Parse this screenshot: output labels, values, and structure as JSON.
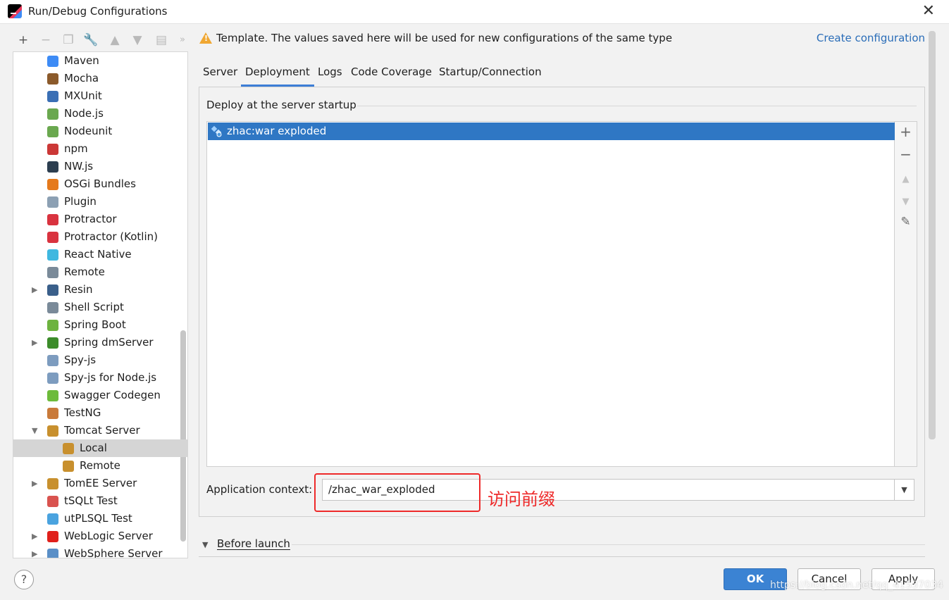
{
  "window": {
    "title": "Run/Debug Configurations"
  },
  "tree": {
    "items": [
      {
        "label": "Maven",
        "icon": "maven-icon",
        "color": "#3d8bf5",
        "expandable": false
      },
      {
        "label": "Mocha",
        "icon": "mocha-icon",
        "color": "#8b5a2b",
        "expandable": false
      },
      {
        "label": "MXUnit",
        "icon": "mxunit-icon",
        "color": "#3a6fb5",
        "expandable": false
      },
      {
        "label": "Node.js",
        "icon": "nodejs-icon",
        "color": "#6aa84f",
        "expandable": false
      },
      {
        "label": "Nodeunit",
        "icon": "nodeunit-icon",
        "color": "#6aa84f",
        "expandable": false
      },
      {
        "label": "npm",
        "icon": "npm-icon",
        "color": "#cb3837",
        "expandable": false
      },
      {
        "label": "NW.js",
        "icon": "nwjs-icon",
        "color": "#2c3e50",
        "expandable": false
      },
      {
        "label": "OSGi Bundles",
        "icon": "osgi-icon",
        "color": "#e57a1c",
        "expandable": false
      },
      {
        "label": "Plugin",
        "icon": "plugin-icon",
        "color": "#8ca0b3",
        "expandable": false
      },
      {
        "label": "Protractor",
        "icon": "protractor-icon",
        "color": "#d9333f",
        "expandable": false
      },
      {
        "label": "Protractor (Kotlin)",
        "icon": "protractor-kotlin-icon",
        "color": "#d9333f",
        "expandable": false
      },
      {
        "label": "React Native",
        "icon": "react-native-icon",
        "color": "#3fb8e0",
        "expandable": false
      },
      {
        "label": "Remote",
        "icon": "remote-icon",
        "color": "#7a8a99",
        "expandable": false
      },
      {
        "label": "Resin",
        "icon": "resin-icon",
        "color": "#3a5f8a",
        "expandable": true
      },
      {
        "label": "Shell Script",
        "icon": "shell-script-icon",
        "color": "#7a8a99",
        "expandable": false
      },
      {
        "label": "Spring Boot",
        "icon": "spring-boot-icon",
        "color": "#6db33f",
        "expandable": false
      },
      {
        "label": "Spring dmServer",
        "icon": "spring-dmserver-icon",
        "color": "#3c8c2a",
        "expandable": true
      },
      {
        "label": "Spy-js",
        "icon": "spyjs-icon",
        "color": "#7d9cbf",
        "expandable": false
      },
      {
        "label": "Spy-js for Node.js",
        "icon": "spyjs-node-icon",
        "color": "#7d9cbf",
        "expandable": false
      },
      {
        "label": "Swagger Codegen",
        "icon": "swagger-icon",
        "color": "#6dbb3b",
        "expandable": false
      },
      {
        "label": "TestNG",
        "icon": "testng-icon",
        "color": "#c97a3a",
        "expandable": false
      },
      {
        "label": "Tomcat Server",
        "icon": "tomcat-icon",
        "color": "#c8902e",
        "expandable": true,
        "expanded": true
      },
      {
        "label": "Local",
        "icon": "tomcat-local-icon",
        "color": "#c8902e",
        "expandable": false,
        "child": true,
        "selected": true
      },
      {
        "label": "Remote",
        "icon": "tomcat-remote-icon",
        "color": "#c8902e",
        "expandable": false,
        "child": true
      },
      {
        "label": "TomEE Server",
        "icon": "tomee-icon",
        "color": "#c8902e",
        "expandable": true
      },
      {
        "label": "tSQLt Test",
        "icon": "tsqlt-icon",
        "color": "#d9534f",
        "expandable": false
      },
      {
        "label": "utPLSQL Test",
        "icon": "utplsql-icon",
        "color": "#4aa3df",
        "expandable": false
      },
      {
        "label": "WebLogic Server",
        "icon": "weblogic-icon",
        "color": "#e0201b",
        "expandable": true
      },
      {
        "label": "WebSphere Server",
        "icon": "websphere-icon",
        "color": "#5a8fc7",
        "expandable": true
      }
    ]
  },
  "header": {
    "template_note": "Template. The values saved here will be used for new configurations of the same type",
    "create_link": "Create configuration"
  },
  "tabs": [
    {
      "label": "Server",
      "active": false
    },
    {
      "label": "Deployment",
      "active": true
    },
    {
      "label": "Logs",
      "active": false
    },
    {
      "label": "Code Coverage",
      "active": false
    },
    {
      "label": "Startup/Connection",
      "active": false
    }
  ],
  "deployment": {
    "section_title": "Deploy at the server startup",
    "artifacts": [
      "zhac:war exploded"
    ],
    "app_context_label": "Application context:",
    "app_context_value": "/zhac_war_exploded",
    "annotation": "访问前缀"
  },
  "before_launch": {
    "label": "Before launch"
  },
  "buttons": {
    "ok": "OK",
    "cancel": "Cancel",
    "apply": "Apply",
    "help": "?"
  },
  "watermark": "https://blog.csdn.net/qq_41537034",
  "colors": {
    "accent": "#3b83d3",
    "selection": "#2f77c4",
    "annotation_red": "#ee2a2a",
    "link": "#2a6db8"
  }
}
